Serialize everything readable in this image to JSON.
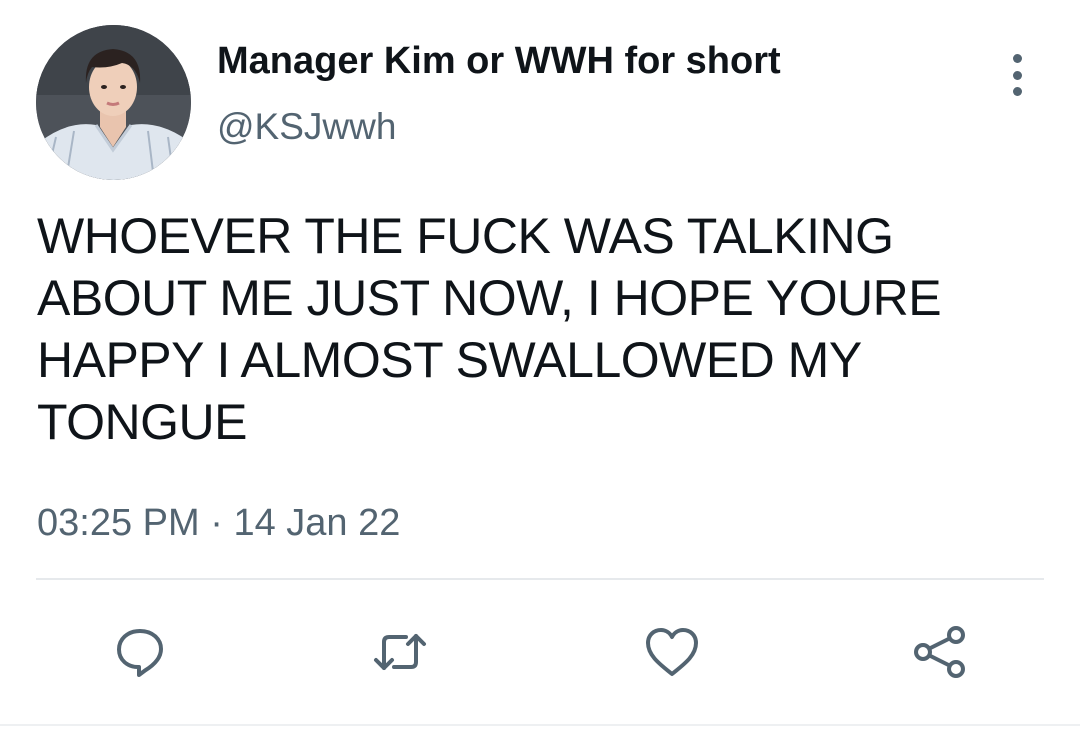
{
  "tweet": {
    "author": {
      "display_name": "Manager Kim or WWH for short",
      "handle": "@KSJwwh",
      "avatar_icon": "profile-photo"
    },
    "text_lines": [
      "WHOEVER THE FUCK WAS TALKING",
      "ABOUT ME JUST NOW, I HOPE YOURE",
      "HAPPY I ALMOST SWALLOWED MY",
      "TONGUE"
    ],
    "time": "03:25 PM",
    "separator": "·",
    "date": "14 Jan 22"
  },
  "actions": [
    {
      "name": "reply",
      "icon": "comment-bubble-icon"
    },
    {
      "name": "retweet",
      "icon": "retweet-icon"
    },
    {
      "name": "like",
      "icon": "heart-icon"
    },
    {
      "name": "share",
      "icon": "share-icon"
    }
  ],
  "colors": {
    "text_primary": "#0f1419",
    "text_secondary": "#536471",
    "divider": "#e6e9ec"
  }
}
